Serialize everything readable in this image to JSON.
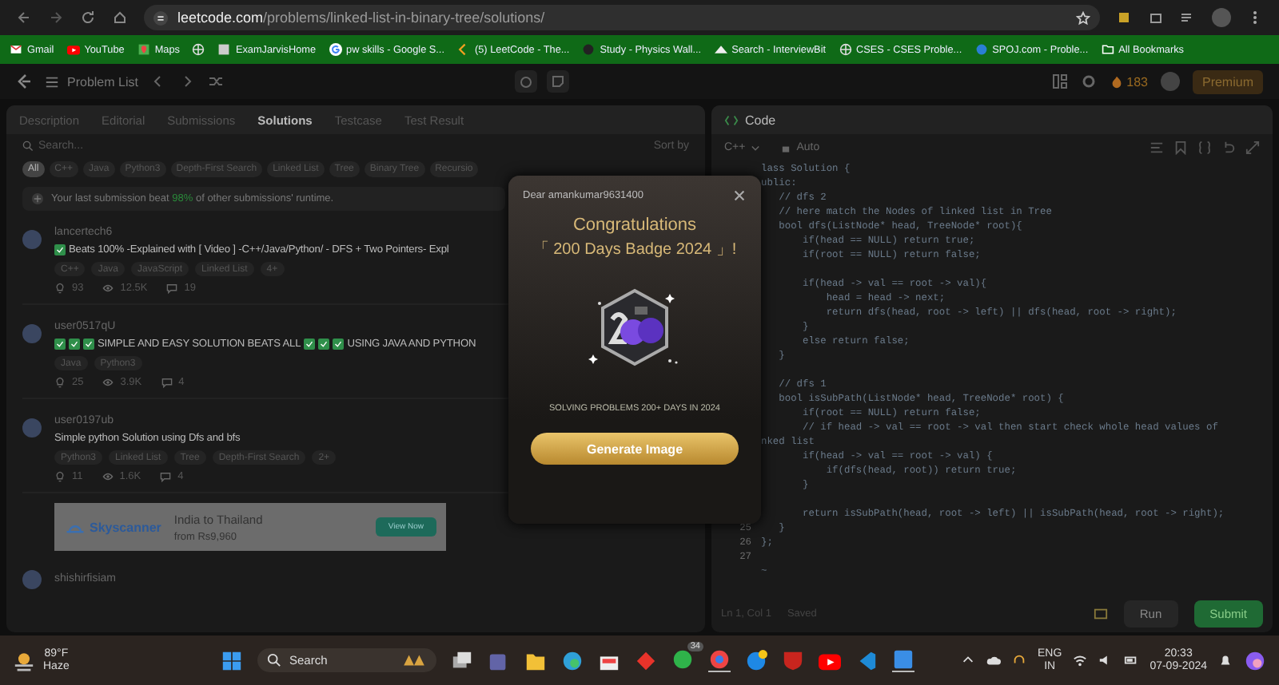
{
  "browser": {
    "url_host": "leetcode.com",
    "url_path": "/problems/linked-list-in-binary-tree/solutions/"
  },
  "bookmarks": [
    {
      "kind": "mail",
      "label": "Gmail"
    },
    {
      "kind": "video",
      "label": "YouTube"
    },
    {
      "kind": "map",
      "label": "Maps"
    },
    {
      "kind": "globe"
    },
    {
      "kind": "page",
      "label": "ExamJarvisHome"
    },
    {
      "kind": "google",
      "label": "pw skills - Google S..."
    },
    {
      "kind": "leetcode",
      "label": "(5) LeetCode - The..."
    },
    {
      "kind": "dot",
      "label": "Study - Physics Wall..."
    },
    {
      "kind": "mountain",
      "label": "Search - InterviewBit"
    },
    {
      "kind": "globe",
      "label": "CSES - CSES Proble..."
    },
    {
      "kind": "circle",
      "label": "SPOJ.com - Proble..."
    }
  ],
  "all_bookmarks": "All Bookmarks",
  "nav": {
    "problem_list": "Problem List",
    "streak": "183",
    "premium": "Premium"
  },
  "left": {
    "tabs": [
      {
        "label": "Description",
        "selected": false
      },
      {
        "label": "Editorial",
        "selected": false
      },
      {
        "label": "Submissions",
        "selected": false
      },
      {
        "label": "Solutions",
        "selected": true
      },
      {
        "label": "Testcase",
        "selected": false
      },
      {
        "label": "Test Result",
        "selected": false
      }
    ],
    "search": {
      "placeholder": "Search..."
    },
    "sort": "Sort by",
    "tags": [
      {
        "label": "All",
        "selected": true
      },
      {
        "label": "C++",
        "selected": false
      },
      {
        "label": "Java",
        "selected": false
      },
      {
        "label": "Python3",
        "selected": false
      },
      {
        "label": "Depth-First Search",
        "selected": false
      },
      {
        "label": "Linked List",
        "selected": false
      },
      {
        "label": "Tree",
        "selected": false
      },
      {
        "label": "Binary Tree",
        "selected": false
      },
      {
        "label": "Recursio",
        "selected": false
      }
    ],
    "banner": {
      "before": "Your last submission beat ",
      "highlight": "98%",
      "after": " of other submissions' runtime."
    },
    "posts": [
      {
        "author": "lancertech6",
        "title_parts": [
          {
            "kind": "check"
          },
          {
            "kind": "text",
            "text": "Beats 100% -Explained with [ Video ] -C++/Java/Python/ - DFS + Two Pointers- Expl"
          }
        ],
        "tags": [
          "C++",
          "Java",
          "JavaScript",
          "Linked List",
          "4+"
        ],
        "upvotes": "93",
        "views": "12.5K",
        "comments": "19"
      },
      {
        "author": "user0517qU",
        "title_parts": [
          {
            "kind": "check"
          },
          {
            "kind": "check"
          },
          {
            "kind": "check"
          },
          {
            "kind": "text",
            "text": "SIMPLE AND EASY SOLUTION BEATS ALL"
          },
          {
            "kind": "check"
          },
          {
            "kind": "check"
          },
          {
            "kind": "check"
          },
          {
            "kind": "text",
            "text": "USING JAVA AND PYTHON"
          }
        ],
        "tags": [
          "Java",
          "Python3"
        ],
        "upvotes": "25",
        "views": "3.9K",
        "comments": "4"
      },
      {
        "author": "user0197ub",
        "title_parts": [
          {
            "kind": "text",
            "text": "Simple python Solution using Dfs and bfs"
          }
        ],
        "tags": [
          "Python3",
          "Linked List",
          "Tree",
          "Depth-First Search",
          "2+"
        ],
        "upvotes": "11",
        "views": "1.6K",
        "comments": "4"
      }
    ],
    "ad": {
      "brand": "Skyscanner",
      "headline": "India to Thailand",
      "price": "from Rs9,960",
      "cta": "View Now"
    },
    "last_author": "shishirfisiam"
  },
  "code": {
    "title": "Code",
    "language": "C++",
    "mode": "Auto",
    "lines": [
      {
        "kind": "code",
        "text": "lass Solution {"
      },
      {
        "kind": "code",
        "text": "ublic:"
      },
      {
        "kind": "code",
        "text": "   // dfs 2"
      },
      {
        "kind": "code",
        "text": "   // here match the Nodes of linked list in Tree"
      },
      {
        "kind": "code",
        "text": "   bool dfs(ListNode* head, TreeNode* root){"
      },
      {
        "kind": "code",
        "text": "       if(head == NULL) return true;"
      },
      {
        "kind": "code",
        "text": "       if(root == NULL) return false;"
      },
      {
        "kind": "blank"
      },
      {
        "kind": "code",
        "text": "       if(head -> val == root -> val){"
      },
      {
        "kind": "code",
        "text": "           head = head -> next;"
      },
      {
        "kind": "code",
        "text": "           return dfs(head, root -> left) || dfs(head, root -> right);"
      },
      {
        "kind": "code",
        "text": "       }"
      },
      {
        "kind": "code",
        "text": "       else return false;"
      },
      {
        "kind": "code",
        "text": "   }"
      },
      {
        "kind": "blank"
      },
      {
        "kind": "code",
        "text": "   // dfs 1"
      },
      {
        "kind": "code",
        "text": "   bool isSubPath(ListNode* head, TreeNode* root) {"
      },
      {
        "kind": "code",
        "text": "       if(root == NULL) return false;"
      },
      {
        "kind": "code",
        "text": "       // if head -> val == root -> val then start check whole head values of"
      },
      {
        "kind": "code",
        "text": "nked list"
      },
      {
        "kind": "code",
        "text": "       if(head -> val == root -> val) {"
      },
      {
        "kind": "code",
        "text": "           if(dfs(head, root)) return true;"
      },
      {
        "kind": "code",
        "text": "       }"
      },
      {
        "kind": "blank"
      },
      {
        "kind": "code",
        "text": "       return isSubPath(head, root -> left) || isSubPath(head, root -> right);"
      },
      {
        "kind": "code",
        "number": "25",
        "text": "   }"
      },
      {
        "kind": "code",
        "number": "26",
        "text": "};"
      },
      {
        "kind": "blank",
        "number": "27"
      },
      {
        "kind": "code",
        "text": "~"
      }
    ],
    "status": "Ln 1, Col 1",
    "saved": "Saved",
    "run": "Run",
    "submit": "Submit"
  },
  "modal": {
    "greeting": "Dear amankumar9631400",
    "title": "Congratulations",
    "badge_name": "「 200 Days Badge 2024 」!",
    "caption": "SOLVING PROBLEMS 200+ DAYS IN 2024",
    "button": "Generate Image"
  },
  "taskbar": {
    "temperature": "89°F",
    "weather": "Haze",
    "search": "Search",
    "chat_badge": "34",
    "language": "ENG",
    "region": "IN",
    "time": "20:33",
    "date": "07-09-2024"
  }
}
